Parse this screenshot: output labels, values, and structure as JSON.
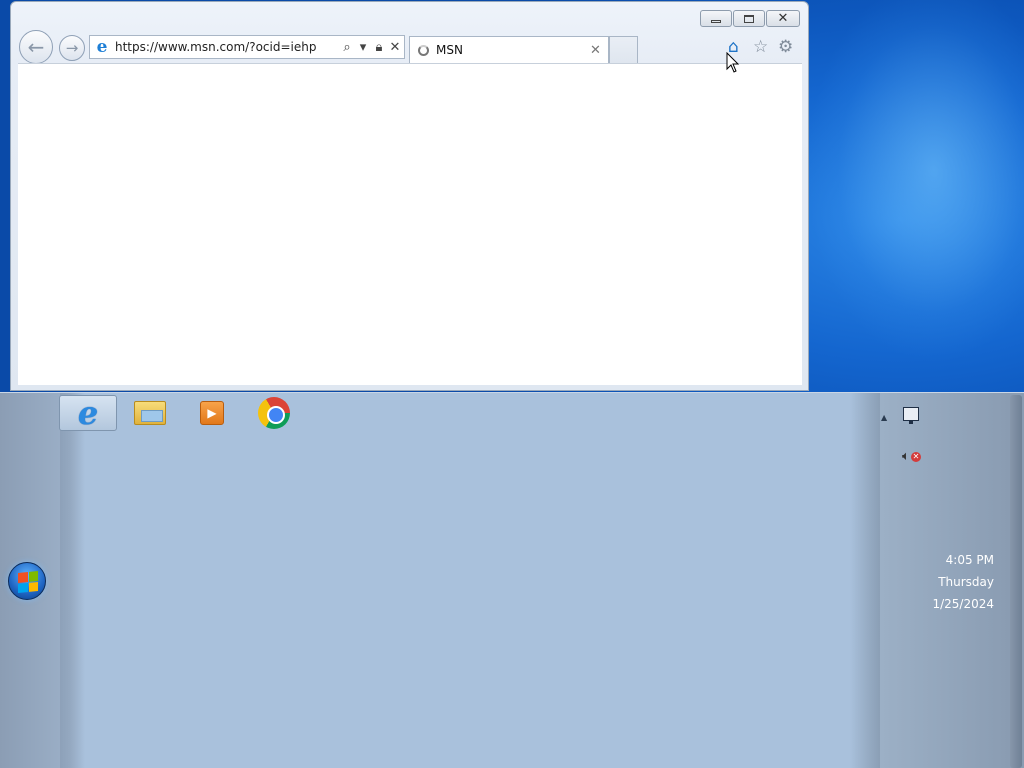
{
  "browser": {
    "address_url": "https://www.msn.com/?ocid=iehp",
    "tab_title": "MSN",
    "icons": {
      "back": "back-arrow-icon",
      "forward": "forward-arrow-icon",
      "search": "search-icon",
      "lock": "lock-icon",
      "stop": "close-icon",
      "home": "home-icon",
      "favorites": "star-icon",
      "tools": "gear-icon"
    }
  },
  "taskbar": {
    "pinned": [
      {
        "name": "Internet Explorer",
        "icon": "internet-explorer-icon",
        "active": true
      },
      {
        "name": "Windows Explorer",
        "icon": "folder-icon"
      },
      {
        "name": "Windows Media Player",
        "icon": "media-player-icon"
      },
      {
        "name": "Google Chrome",
        "icon": "chrome-icon"
      }
    ],
    "tray": {
      "icons": [
        "show-hidden-icons-icon",
        "network-icon",
        "volume-muted-icon"
      ]
    },
    "clock": {
      "time": "4:05 PM",
      "day": "Thursday",
      "date": "1/25/2024"
    }
  },
  "colors": {
    "taskbar": "#a9c1dc",
    "desktop": "#1466cf",
    "ie_accent": "#1f74c7"
  }
}
